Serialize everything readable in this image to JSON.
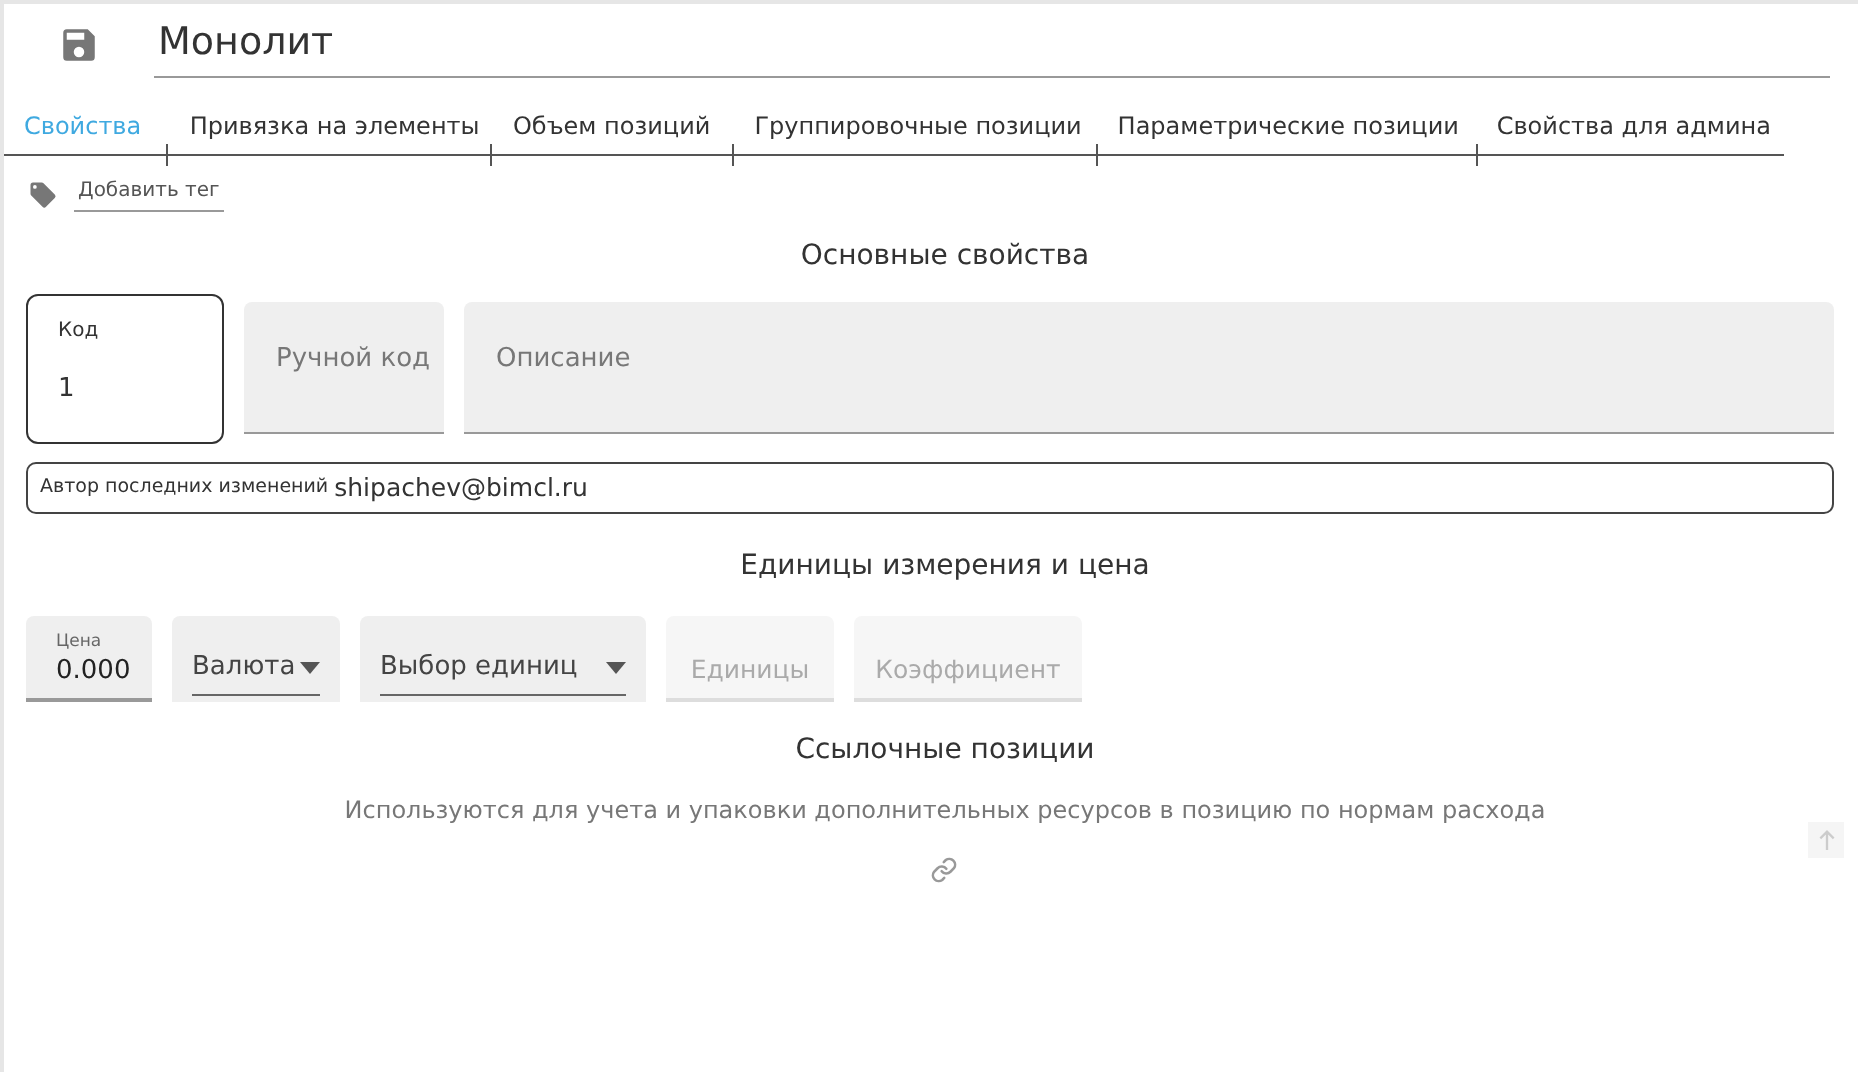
{
  "title": "Монолит",
  "tabs": [
    {
      "label": "Свойства",
      "selected": true
    },
    {
      "label": "Привязка на элементы",
      "selected": false
    },
    {
      "label": "Объем позиций",
      "selected": false
    },
    {
      "label": "Группировочные позиции",
      "selected": false
    },
    {
      "label": "Параметрические позиции",
      "selected": false
    },
    {
      "label": "Свойства для админа",
      "selected": false
    }
  ],
  "add_tag": "Добавить тег",
  "main_section": {
    "heading": "Основные свойства",
    "fields": [
      {
        "label": "Код",
        "value": "1",
        "focused": true
      },
      {
        "label": "Ручной код",
        "focused": false
      },
      {
        "label": "Описание",
        "focused": false
      }
    ],
    "author_label": "Автор последних изменений",
    "author_value": "shipachev@bimcl.ru"
  },
  "units_section": {
    "heading": "Единицы измерения и цена",
    "fields": [
      {
        "kind": "input",
        "label": "Цена",
        "value": "0.000",
        "disabled": false
      },
      {
        "kind": "select",
        "label": "Валюта",
        "disabled": false
      },
      {
        "kind": "select",
        "label": "Выбор единиц",
        "disabled": false
      },
      {
        "kind": "input",
        "label": "Единицы",
        "disabled": true
      },
      {
        "kind": "input",
        "label": "Коэффициент",
        "disabled": true
      }
    ]
  },
  "ref_section": {
    "heading": "Ссылочные позиции",
    "description": "Используются для учета и упаковки дополнительных ресурсов в позицию по нормам расхода"
  }
}
